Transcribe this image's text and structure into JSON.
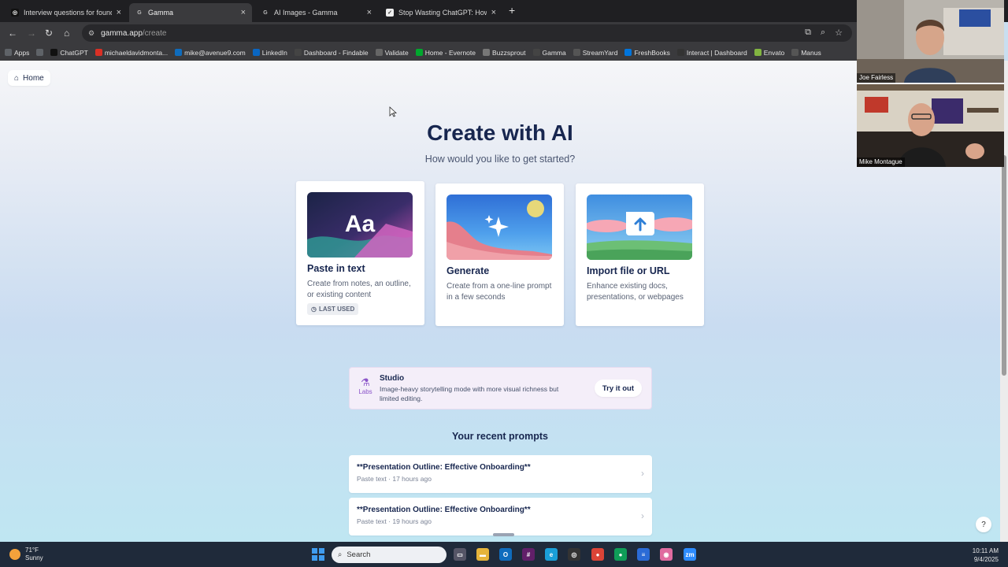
{
  "browser": {
    "tabs": [
      {
        "title": "Interview questions for founder",
        "icon": "chatgpt-icon",
        "active": false
      },
      {
        "title": "Gamma",
        "icon": "gamma-icon",
        "active": true
      },
      {
        "title": "AI Images - Gamma",
        "icon": "gamma-icon",
        "active": false
      },
      {
        "title": "Stop Wasting ChatGPT: How to",
        "icon": "tab-favicon",
        "active": false
      }
    ],
    "new_tab": "+",
    "url_host": "gamma.app",
    "url_path": "/create",
    "bookmarks": [
      {
        "label": "Apps",
        "icon": "apps-grid-icon",
        "color": "#5f6368"
      },
      {
        "label": "",
        "icon": "grid-icon",
        "color": "#5f6368"
      },
      {
        "label": "ChatGPT",
        "icon": "chatgpt-icon",
        "color": "#111111"
      },
      {
        "label": "michaeldavidmonta...",
        "icon": "gmail-icon",
        "color": "#d93025"
      },
      {
        "label": "mike@avenue9.com",
        "icon": "outlook-icon",
        "color": "#0f6cbd"
      },
      {
        "label": "LinkedIn",
        "icon": "linkedin-icon",
        "color": "#0a66c2"
      },
      {
        "label": "Dashboard - Findable",
        "icon": "findable-icon",
        "color": "#444444"
      },
      {
        "label": "Validate",
        "icon": "validate-icon",
        "color": "#666666"
      },
      {
        "label": "Home - Evernote",
        "icon": "evernote-icon",
        "color": "#00a82d"
      },
      {
        "label": "Buzzsprout",
        "icon": "buzzsprout-icon",
        "color": "#777777"
      },
      {
        "label": "Gamma",
        "icon": "gamma-icon",
        "color": "#444444"
      },
      {
        "label": "StreamYard",
        "icon": "streamyard-icon",
        "color": "#555555"
      },
      {
        "label": "FreshBooks",
        "icon": "freshbooks-icon",
        "color": "#0075dd"
      },
      {
        "label": "Interact | Dashboard",
        "icon": "interact-icon",
        "color": "#333333"
      },
      {
        "label": "Envato",
        "icon": "envato-icon",
        "color": "#82b541"
      },
      {
        "label": "Manus",
        "icon": "manus-icon",
        "color": "#555555"
      }
    ]
  },
  "page": {
    "home_label": "Home",
    "title": "Create with AI",
    "subtitle": "How would you like to get started?",
    "cards": [
      {
        "title": "Paste in text",
        "desc": "Create from notes, an outline, or existing content",
        "badge": "LAST USED",
        "art_text": "Aa"
      },
      {
        "title": "Generate",
        "desc": "Create from a one-line prompt in a few seconds"
      },
      {
        "title": "Import file or URL",
        "desc": "Enhance existing docs, presentations, or webpages"
      }
    ],
    "studio": {
      "labs": "Labs",
      "name": "Studio",
      "desc": "Image-heavy storytelling mode with more visual richness but limited editing.",
      "cta": "Try it out"
    },
    "recent_heading": "Your recent prompts",
    "recent": [
      {
        "title": "**Presentation Outline: Effective Onboarding**",
        "meta": "Paste text · 17 hours ago"
      },
      {
        "title": "**Presentation Outline: Effective Onboarding**",
        "meta": "Paste text · 19 hours ago"
      }
    ],
    "help": "?"
  },
  "video": {
    "participants": [
      "Joe Fairless",
      "Mike Montague"
    ]
  },
  "taskbar": {
    "temp": "71°F",
    "condition": "Sunny",
    "search_placeholder": "Search",
    "time": "10:11 AM",
    "date": "9/4/2025"
  }
}
